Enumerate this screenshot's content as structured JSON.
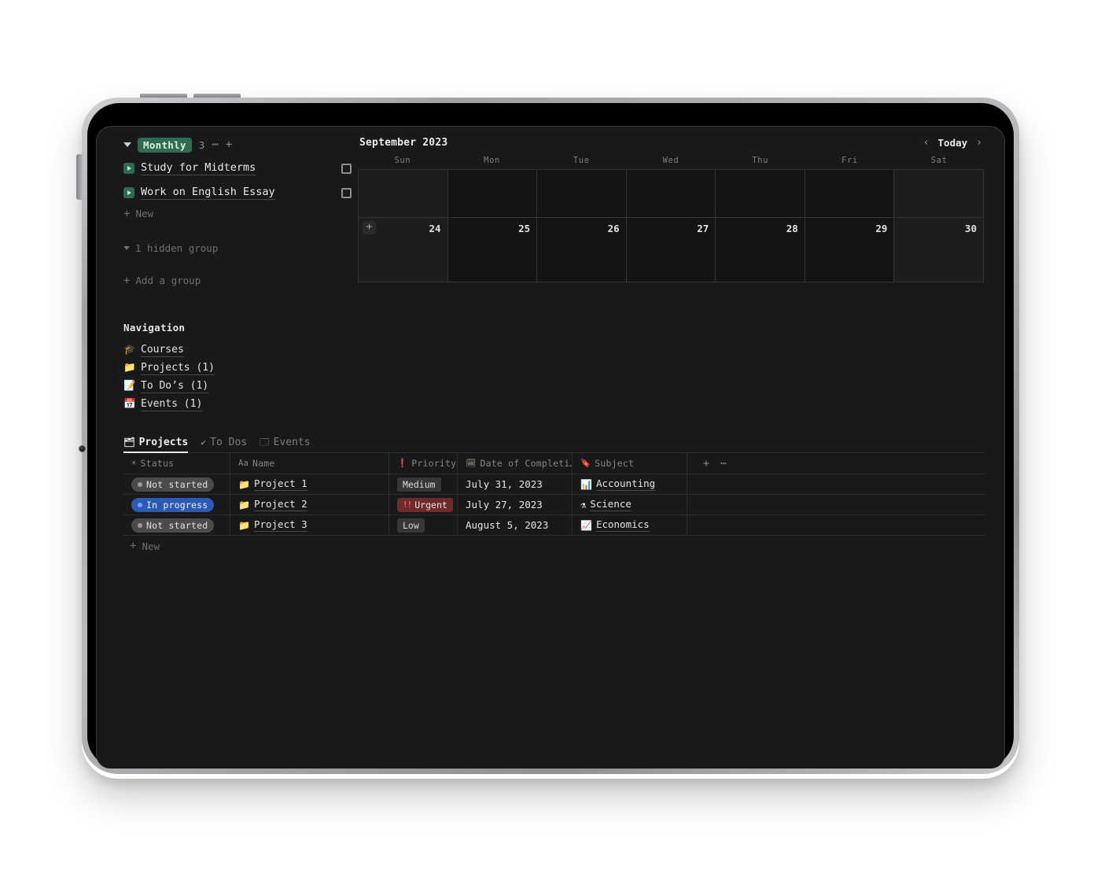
{
  "board": {
    "group_badge": "Monthly",
    "group_count": "3",
    "more_icon": "⋯",
    "add_icon": "+",
    "items": [
      {
        "label": "Study for Midterms"
      },
      {
        "label": "Work on English Essay"
      }
    ],
    "new_label": "New",
    "hidden_group_label": "1 hidden group",
    "add_group_label": "Add a group"
  },
  "calendar": {
    "title": "September 2023",
    "prev_icon": "‹",
    "today_label": "Today",
    "next_icon": "›",
    "day_headers": [
      "Sun",
      "Mon",
      "Tue",
      "Wed",
      "Thu",
      "Fri",
      "Sat"
    ],
    "row1": [
      "",
      "",
      "",
      "",
      "",
      "",
      ""
    ],
    "row2": [
      "24",
      "25",
      "26",
      "27",
      "28",
      "29",
      "30"
    ],
    "cell_add_icon": "+",
    "weekend_columns": [
      0,
      6
    ]
  },
  "navigation": {
    "title": "Navigation",
    "items": [
      {
        "emoji": "🎓",
        "label": "Courses"
      },
      {
        "emoji": "📁",
        "label": "Projects (1)"
      },
      {
        "emoji": "📝",
        "label": "To Do’s (1)"
      },
      {
        "emoji": "📅",
        "label": "Events (1)"
      }
    ]
  },
  "database": {
    "tabs": [
      {
        "icon": "🗂",
        "label": "Projects",
        "active": true
      },
      {
        "icon": "✔",
        "label": "To Dos",
        "active": false
      },
      {
        "icon": "🗔",
        "label": "Events",
        "active": false
      }
    ],
    "columns": [
      {
        "icon": "☀",
        "label": "Status"
      },
      {
        "icon": "Aa",
        "label": "Name"
      },
      {
        "icon": "❗",
        "label": "Priority"
      },
      {
        "icon": "🗓",
        "label": "Date of Completi…"
      },
      {
        "icon": "🔖",
        "label": "Subject"
      }
    ],
    "add_column_icon": "+",
    "column_more_icon": "⋯",
    "rows": [
      {
        "status": "Not started",
        "status_style": "notstarted",
        "name": "Project 1",
        "name_emoji": "📁",
        "priority": "Medium",
        "priority_style": "medium",
        "date": "July 31, 2023",
        "subject": "Accounting",
        "subject_emoji": "📊"
      },
      {
        "status": "In progress",
        "status_style": "inprogress",
        "name": "Project 2",
        "name_emoji": "📁",
        "priority": "Urgent",
        "priority_style": "urgent",
        "date": "July 27, 2023",
        "subject": "Science",
        "subject_emoji": "⚗"
      },
      {
        "status": "Not started",
        "status_style": "notstarted",
        "name": "Project 3",
        "name_emoji": "📁",
        "priority": "Low",
        "priority_style": "low",
        "date": "August 5, 2023",
        "subject": "Economics",
        "subject_emoji": "📈"
      }
    ],
    "new_row_label": "New",
    "new_row_icon": "+"
  },
  "colors": {
    "page_bg": "#191919",
    "panel_border": "#3b3b3b",
    "accent_green": "#2f6b4f",
    "accent_blue": "#2b5bb5",
    "accent_red": "#6e2b2b",
    "text_primary": "#e6e6e4",
    "text_muted": "#7d7d7b"
  }
}
